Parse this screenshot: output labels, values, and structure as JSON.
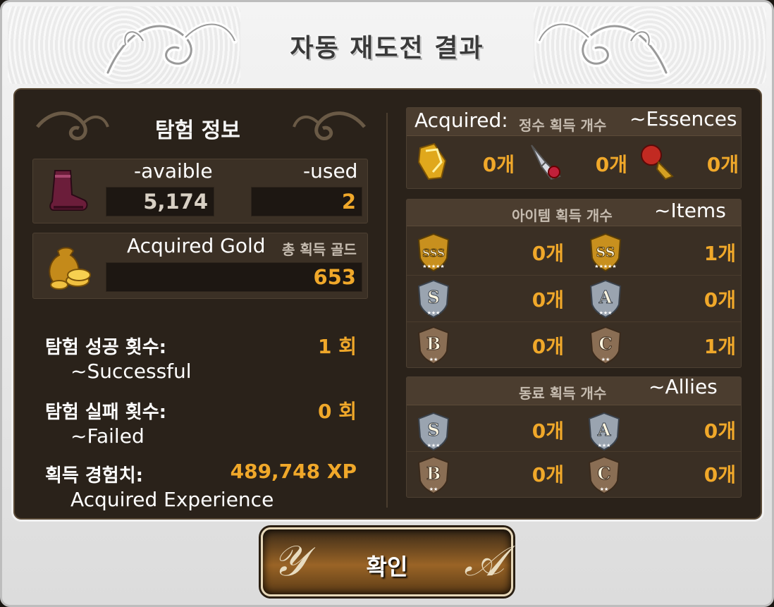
{
  "dialog": {
    "title": "자동 재도전 결과",
    "confirm_button": "확인"
  },
  "expedition_info": {
    "title": "탐험 정보",
    "stamina": {
      "icon": "boot-icon",
      "available_label": "-avaible",
      "used_label": "-used",
      "available_value": "5,174",
      "used_value": "2"
    },
    "gold": {
      "icon": "gold-bag-icon",
      "label_en": "Acquired Gold",
      "label_ko": "총 획득 골드",
      "value": "653"
    },
    "stats": [
      {
        "label_ko": "탐험 성공 횟수:",
        "value": "1 회",
        "label_en": "~Successful"
      },
      {
        "label_ko": "탐험 실패 횟수:",
        "value": "0 회",
        "label_en": "~Failed"
      },
      {
        "label_ko": "획득 경험치:",
        "value": "489,748 XP",
        "label_en": "Acquired Experience"
      }
    ]
  },
  "essences": {
    "title_en_prefix": "Acquired:",
    "title_ko": "정수 획득 개수",
    "title_en_suffix": "~Essences",
    "items": [
      {
        "icon": "gold-essence-icon",
        "count": "0개"
      },
      {
        "icon": "red-crystal-essence-icon",
        "count": "0개"
      },
      {
        "icon": "red-gem-essence-icon",
        "count": "0개"
      }
    ]
  },
  "items": {
    "title_ko": "아이템 획득 개수",
    "title_en": "~Items",
    "grades": [
      {
        "grade": "SSS",
        "count": "0개"
      },
      {
        "grade": "SS",
        "count": "1개"
      },
      {
        "grade": "S",
        "count": "0개"
      },
      {
        "grade": "A",
        "count": "0개"
      },
      {
        "grade": "B",
        "count": "0개"
      },
      {
        "grade": "C",
        "count": "1개"
      }
    ]
  },
  "allies": {
    "title_ko": "동료 획득 개수",
    "title_en": "~Allies",
    "grades": [
      {
        "grade": "S",
        "count": "0개"
      },
      {
        "grade": "A",
        "count": "0개"
      },
      {
        "grade": "B",
        "count": "0개"
      },
      {
        "grade": "C",
        "count": "0개"
      }
    ]
  },
  "colors": {
    "accent_orange": "#f0a82a",
    "panel_bg": "#2a221a",
    "frame_bg": "#e8e8e8"
  }
}
